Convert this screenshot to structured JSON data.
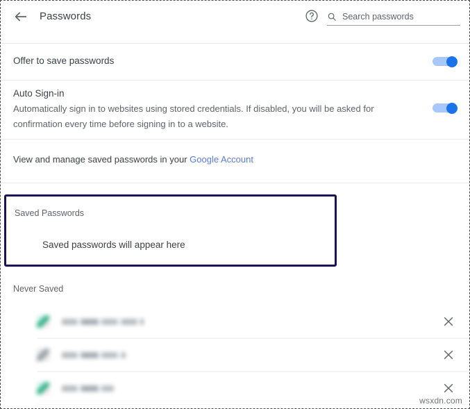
{
  "window": {
    "watermark": "wsxdn.com"
  },
  "header": {
    "back_icon": "back-arrow-icon",
    "title": "Passwords",
    "help_icon": "help-circle-icon",
    "search": {
      "icon": "search-icon",
      "placeholder": "Search passwords",
      "value": ""
    }
  },
  "settings": {
    "offer_to_save": {
      "label": "Offer to save passwords",
      "toggle_state": "on"
    },
    "auto_sign_in": {
      "label": "Auto Sign-in",
      "description": "Automatically sign in to websites using stored credentials. If disabled, you will be asked for confirmation every time before signing in to a website.",
      "toggle_state": "on"
    },
    "manage": {
      "text": "View and manage saved passwords in your ",
      "link_label": "Google Account"
    }
  },
  "saved_passwords": {
    "section_title": "Saved Passwords",
    "empty_message": "Saved passwords will appear here",
    "highlighted": true,
    "highlight_color": "#1b1254"
  },
  "never_saved": {
    "section_title": "Never Saved",
    "rows": [
      {
        "favicon": "site-favicon-teal",
        "site": "",
        "remove_icon": "close-icon"
      },
      {
        "favicon": "site-favicon-gray",
        "site": "",
        "remove_icon": "close-icon"
      },
      {
        "favicon": "site-favicon-teal",
        "site": "",
        "remove_icon": "close-icon"
      }
    ]
  },
  "colors": {
    "accent_blue": "#1a73e8",
    "toggle_track": "#a8c7fa",
    "link_blue": "#5b7bd5",
    "text_primary": "#3c4043",
    "text_secondary": "#5f6368",
    "highlight_navy": "#1b1254"
  }
}
